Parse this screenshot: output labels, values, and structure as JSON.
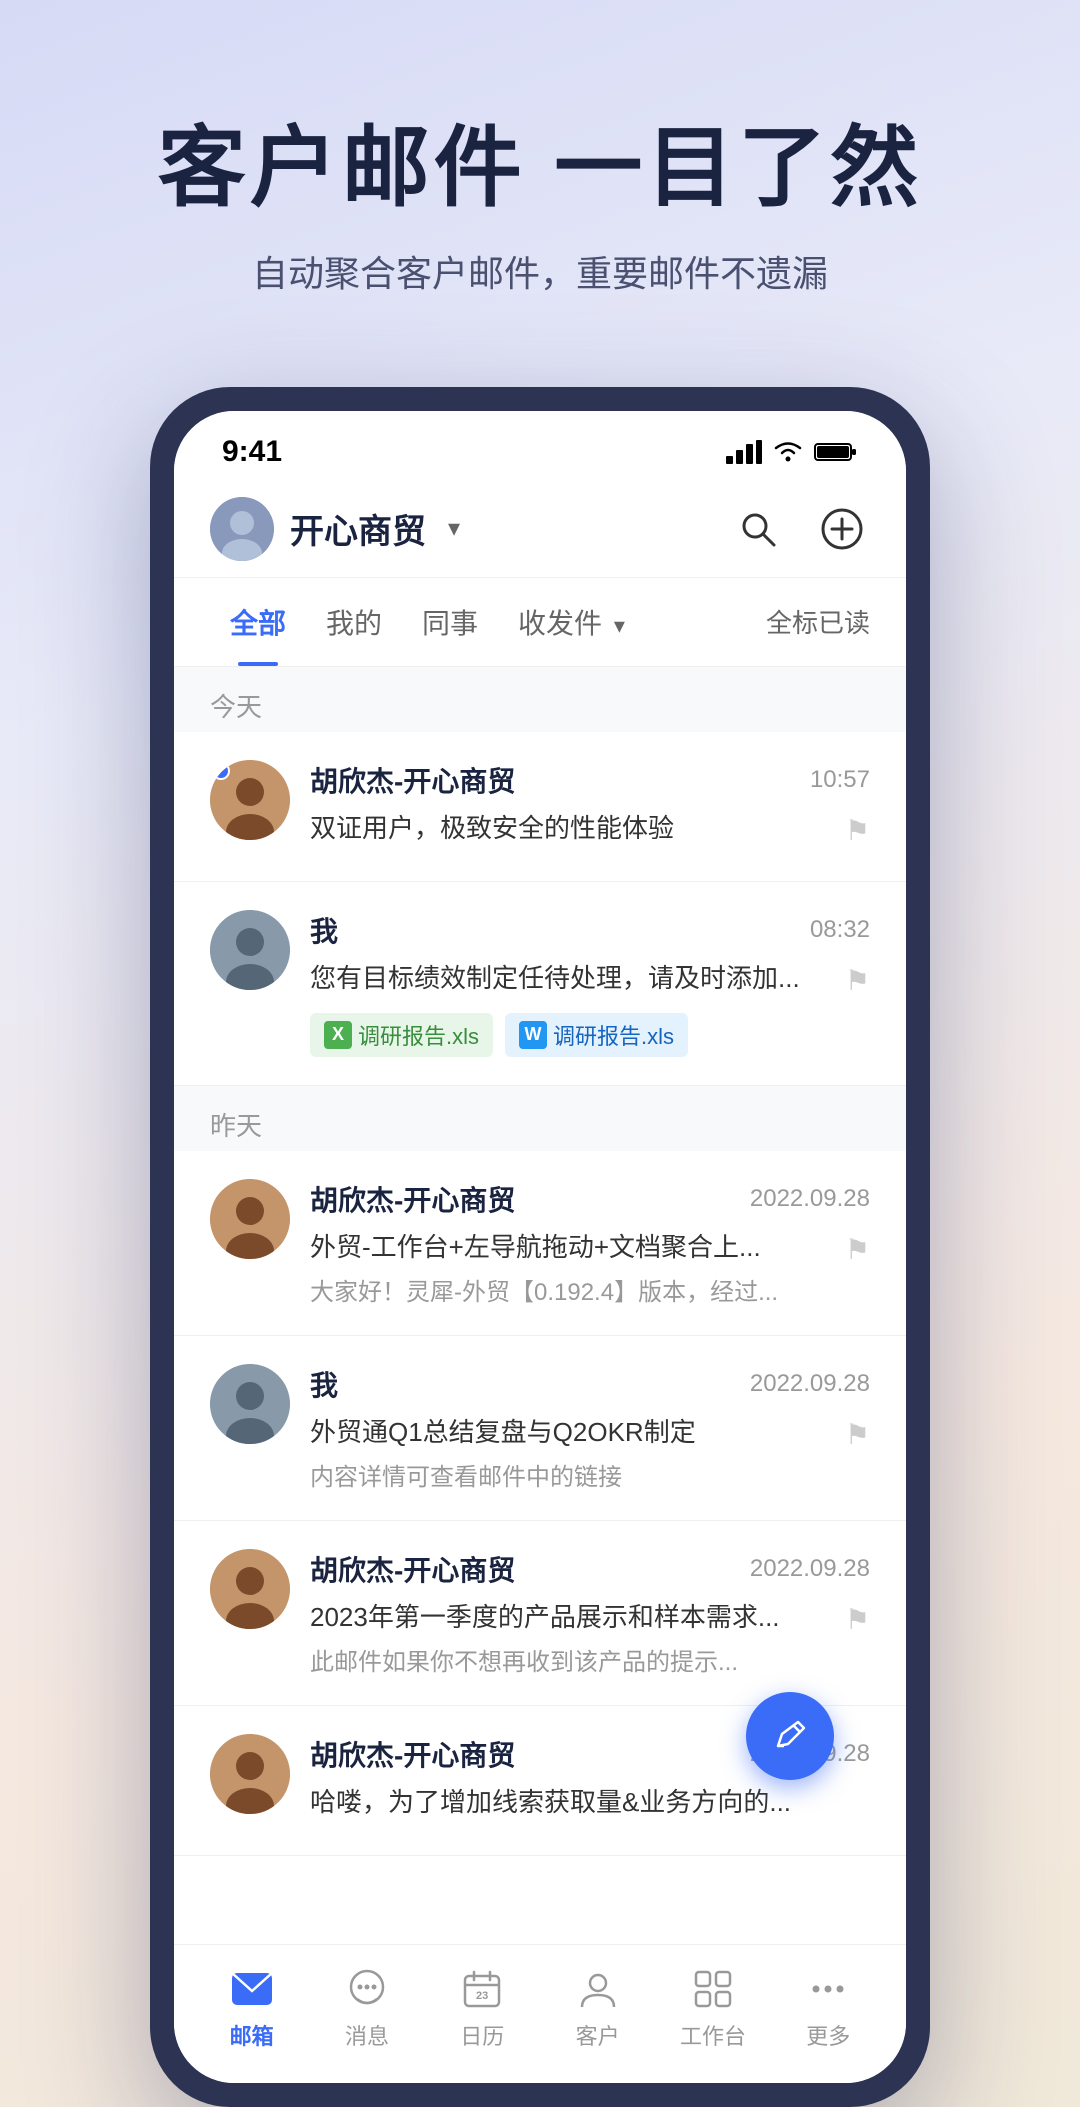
{
  "hero": {
    "title": "客户邮件 一目了然",
    "subtitle": "自动聚合客户邮件，重要邮件不遗漏"
  },
  "phone": {
    "status_bar": {
      "time": "9:41"
    },
    "header": {
      "company": "开心商贸",
      "search_label": "搜索",
      "add_label": "新建"
    },
    "tabs": [
      {
        "label": "全部",
        "active": true
      },
      {
        "label": "我的",
        "active": false
      },
      {
        "label": "同事",
        "active": false
      },
      {
        "label": "收发件",
        "active": false,
        "has_dropdown": true
      },
      {
        "label": "全标已读",
        "active": false
      }
    ],
    "sections": [
      {
        "date_label": "今天",
        "emails": [
          {
            "sender": "胡欣杰-开心商贸",
            "time": "10:57",
            "subject": "双证用户，极致安全的性能体验",
            "preview": "",
            "unread": true,
            "avatar_type": "brown",
            "attachments": []
          },
          {
            "sender": "我",
            "time": "08:32",
            "subject": "您有目标绩效制定任待处理，请及时添加...",
            "preview": "",
            "unread": false,
            "avatar_type": "gray",
            "attachments": [
              {
                "type": "excel",
                "name": "调研报告.xls"
              },
              {
                "type": "word",
                "name": "调研报告.xls"
              }
            ]
          }
        ]
      },
      {
        "date_label": "昨天",
        "emails": [
          {
            "sender": "胡欣杰-开心商贸",
            "time": "2022.09.28",
            "subject": "外贸-工作台+左导航拖动+文档聚合上...",
            "preview": "大家好！灵犀-外贸【0.192.4】版本，经过...",
            "unread": false,
            "avatar_type": "brown",
            "attachments": []
          },
          {
            "sender": "我",
            "time": "2022.09.28",
            "subject": "外贸通Q1总结复盘与Q2OKR制定",
            "preview": "内容详情可查看邮件中的链接",
            "unread": false,
            "avatar_type": "gray",
            "attachments": []
          },
          {
            "sender": "胡欣杰-开心商贸",
            "time": "2022.09.28",
            "subject": "2023年第一季度的产品展示和样本需求...",
            "preview": "此邮件如果你不想再收到该产品的提示...",
            "unread": false,
            "avatar_type": "brown",
            "attachments": []
          },
          {
            "sender": "胡欣杰-开心商贸",
            "time": "2022.09.28",
            "subject": "哈喽，为了增加线索获取量&业务方向的...",
            "preview": "",
            "unread": false,
            "avatar_type": "brown",
            "attachments": []
          }
        ]
      }
    ],
    "bottom_nav": [
      {
        "label": "邮箱",
        "active": true,
        "icon": "mail"
      },
      {
        "label": "消息",
        "active": false,
        "icon": "message"
      },
      {
        "label": "日历",
        "active": false,
        "icon": "calendar"
      },
      {
        "label": "客户",
        "active": false,
        "icon": "contacts"
      },
      {
        "label": "工作台",
        "active": false,
        "icon": "dashboard"
      },
      {
        "label": "更多",
        "active": false,
        "icon": "more"
      }
    ]
  }
}
